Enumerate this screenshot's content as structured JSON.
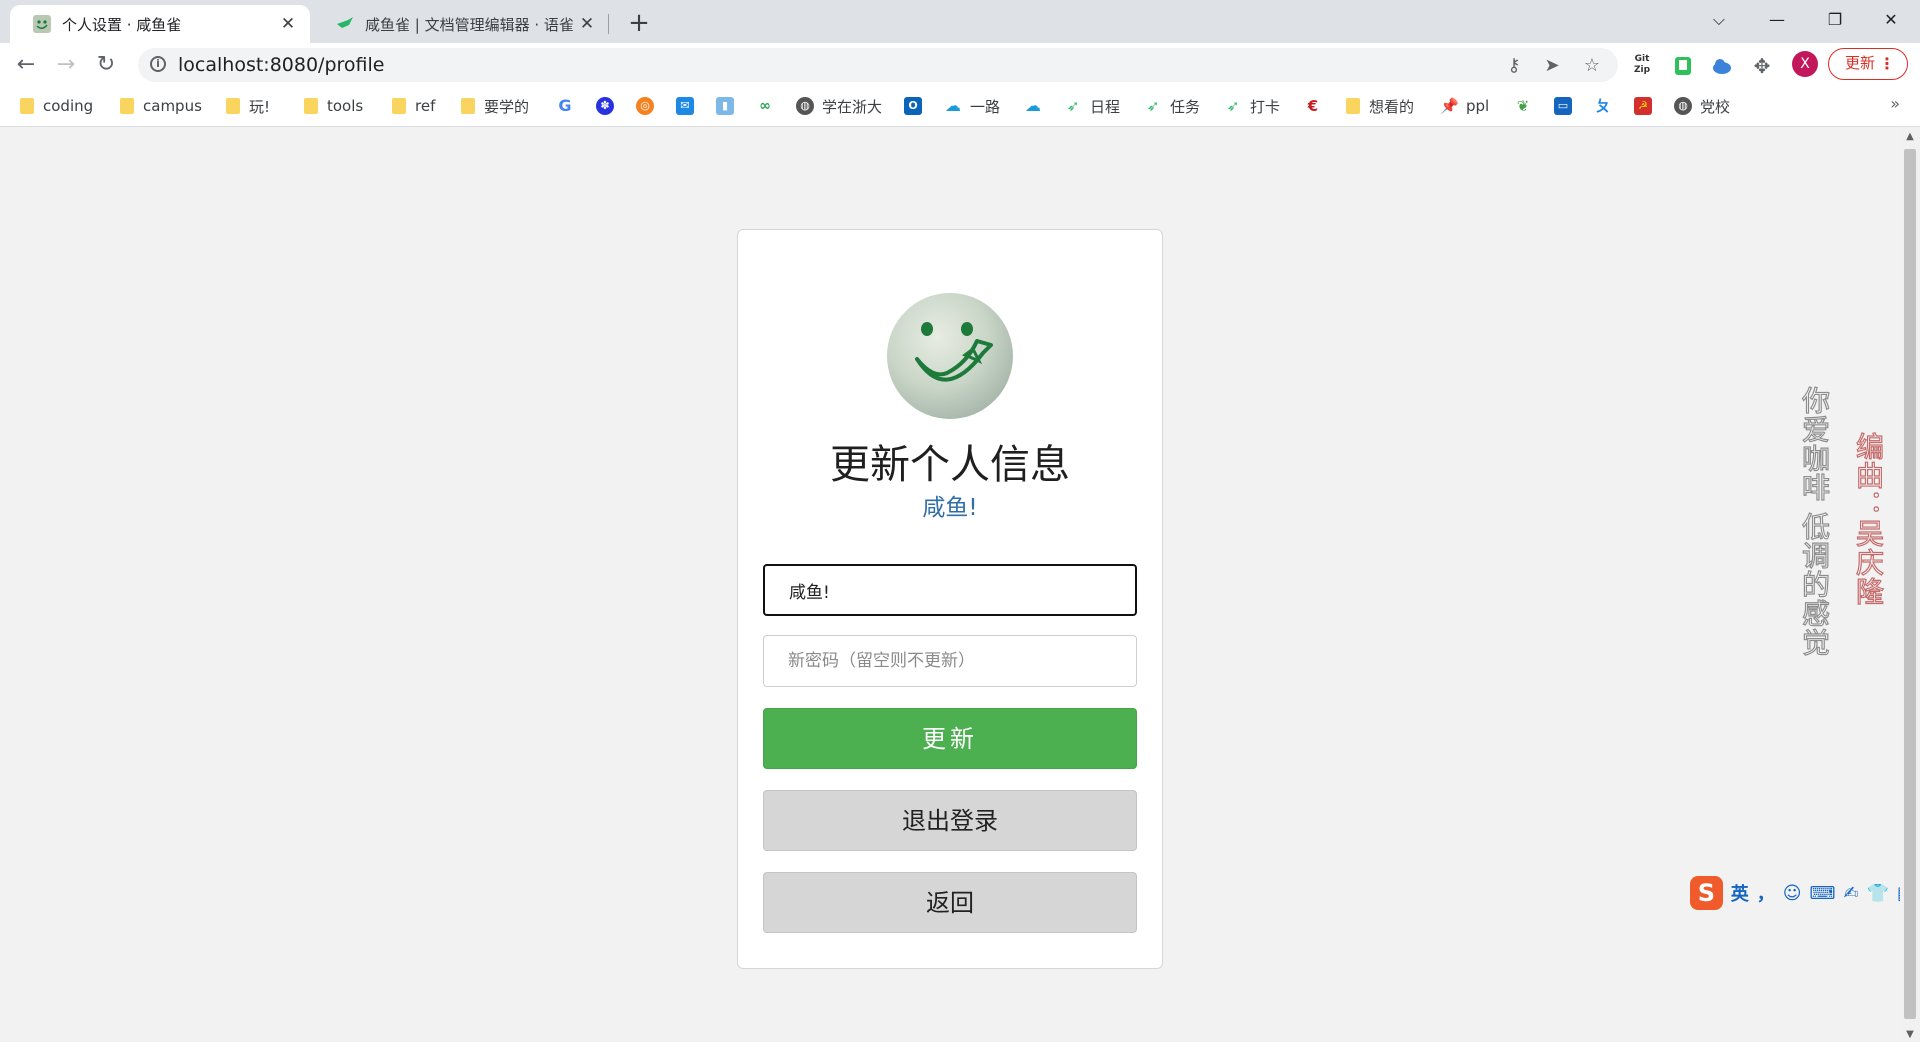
{
  "browser": {
    "tabs": [
      {
        "title": "个人设置 · 咸鱼雀",
        "active": true
      },
      {
        "title": "咸鱼雀 | 文档管理编辑器 · 语雀",
        "active": false
      }
    ],
    "new_tab": "+",
    "window_controls": {
      "dropdown": "⌵",
      "minimize": "—",
      "maximize": "❐",
      "close": "✕"
    },
    "url": "localhost:8080/profile",
    "profile_initial": "X",
    "update_label": "更新",
    "extensions": [
      "Git Zip",
      "green-book",
      "cloud",
      "puzzle"
    ],
    "bookmarks": [
      {
        "label": "coding",
        "type": "folder"
      },
      {
        "label": "campus",
        "type": "folder"
      },
      {
        "label": "玩!",
        "type": "folder"
      },
      {
        "label": "tools",
        "type": "folder"
      },
      {
        "label": "ref",
        "type": "folder"
      },
      {
        "label": "要学的",
        "type": "folder"
      },
      {
        "label": "",
        "type": "google"
      },
      {
        "label": "",
        "type": "baidu"
      },
      {
        "label": "",
        "type": "orange"
      },
      {
        "label": "",
        "type": "mail"
      },
      {
        "label": "",
        "type": "chart"
      },
      {
        "label": "",
        "type": "green"
      },
      {
        "label": "学在浙大",
        "type": "globe"
      },
      {
        "label": "",
        "type": "outlook"
      },
      {
        "label": "一路",
        "type": "blue"
      },
      {
        "label": "",
        "type": "blue2"
      },
      {
        "label": "日程",
        "type": "yuque"
      },
      {
        "label": "任务",
        "type": "yuque"
      },
      {
        "label": "打卡",
        "type": "yuque"
      },
      {
        "label": "",
        "type": "gitee"
      },
      {
        "label": "想看的",
        "type": "folder"
      },
      {
        "label": "ppl",
        "type": "pin"
      },
      {
        "label": "",
        "type": "leaf"
      },
      {
        "label": "",
        "type": "screen"
      },
      {
        "label": "",
        "type": "zju"
      },
      {
        "label": "",
        "type": "party"
      },
      {
        "label": "党校",
        "type": "globe"
      }
    ],
    "bookmarks_more": "»"
  },
  "profile": {
    "title": "更新个人信息",
    "username_display": "咸鱼!",
    "username_value": "咸鱼!",
    "password_placeholder": "新密码（留空则不更新）",
    "update_button": "更新",
    "logout_button": "退出登录",
    "back_button": "返回"
  },
  "decor": {
    "vertical_grey": "你爱咖啡 低调的感觉",
    "vertical_red": "编曲：吴庆隆"
  },
  "ime": {
    "logo": "S",
    "lang": "英",
    "items": [
      "，",
      "☺",
      "⌨",
      "✍",
      "👕",
      "▦"
    ]
  },
  "colors": {
    "primary_button": "#4caf50",
    "secondary_button": "#d6d6d6",
    "subtitle": "#2f6ea6",
    "update_pill": "#d93025"
  }
}
